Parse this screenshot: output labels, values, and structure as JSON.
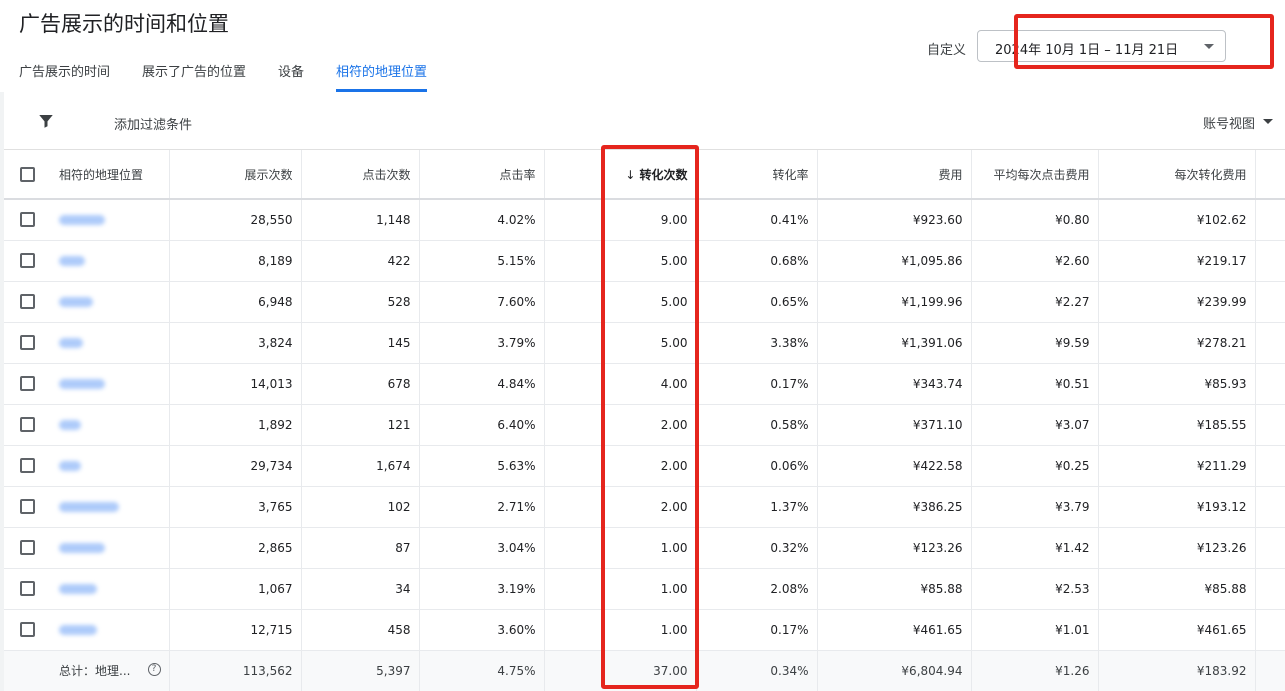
{
  "header": {
    "title": "广告展示的时间和位置"
  },
  "tabs": [
    {
      "label": "广告展示的时间",
      "active": false
    },
    {
      "label": "展示了广告的位置",
      "active": false
    },
    {
      "label": "设备",
      "active": false
    },
    {
      "label": "相符的地理位置",
      "active": true
    }
  ],
  "date_range": {
    "label": "自定义",
    "value": "2024年 10月 1日 – 11月 21日"
  },
  "toolbar": {
    "filter_icon": "funnel-icon",
    "add_filter": "添加过滤条件",
    "view": "账号视图"
  },
  "colors": {
    "accent": "#1a73e8",
    "highlight": "#e5251d"
  },
  "table": {
    "columns": [
      "相符的地理位置",
      "展示次数",
      "点击次数",
      "点击率",
      "转化次数",
      "转化率",
      "费用",
      "平均每次点击费用",
      "每次转化费用"
    ],
    "sort_arrow": "↓",
    "rows": [
      [
        "",
        "28,550",
        "1,148",
        "4.02%",
        "9.00",
        "0.41%",
        "¥923.60",
        "¥0.80",
        "¥102.62"
      ],
      [
        "",
        "8,189",
        "422",
        "5.15%",
        "5.00",
        "0.68%",
        "¥1,095.86",
        "¥2.60",
        "¥219.17"
      ],
      [
        "",
        "6,948",
        "528",
        "7.60%",
        "5.00",
        "0.65%",
        "¥1,199.96",
        "¥2.27",
        "¥239.99"
      ],
      [
        "",
        "3,824",
        "145",
        "3.79%",
        "5.00",
        "3.38%",
        "¥1,391.06",
        "¥9.59",
        "¥278.21"
      ],
      [
        "",
        "14,013",
        "678",
        "4.84%",
        "4.00",
        "0.17%",
        "¥343.74",
        "¥0.51",
        "¥85.93"
      ],
      [
        "",
        "1,892",
        "121",
        "6.40%",
        "2.00",
        "0.58%",
        "¥371.10",
        "¥3.07",
        "¥185.55"
      ],
      [
        "",
        "29,734",
        "1,674",
        "5.63%",
        "2.00",
        "0.06%",
        "¥422.58",
        "¥0.25",
        "¥211.29"
      ],
      [
        "",
        "3,765",
        "102",
        "2.71%",
        "2.00",
        "1.37%",
        "¥386.25",
        "¥3.79",
        "¥193.12"
      ],
      [
        "",
        "2,865",
        "87",
        "3.04%",
        "1.00",
        "0.32%",
        "¥123.26",
        "¥1.42",
        "¥123.26"
      ],
      [
        "",
        "1,067",
        "34",
        "3.19%",
        "1.00",
        "2.08%",
        "¥85.88",
        "¥2.53",
        "¥85.88"
      ],
      [
        "",
        "12,715",
        "458",
        "3.60%",
        "1.00",
        "0.17%",
        "¥461.65",
        "¥1.01",
        "¥461.65"
      ]
    ],
    "total": [
      "总计：地理...",
      "113,562",
      "5,397",
      "4.75%",
      "37.00",
      "0.34%",
      "¥6,804.94",
      "¥1.26",
      "¥183.92"
    ],
    "help_glyph": "?"
  }
}
